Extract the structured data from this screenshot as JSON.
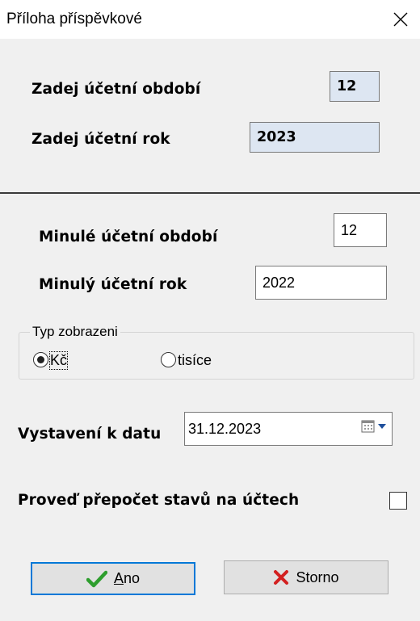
{
  "window": {
    "title": "Příloha příspěvkové"
  },
  "current": {
    "period_label": "Zadej účetní období",
    "period_value": "12",
    "year_label": "Zadej účetní rok",
    "year_value": "2023"
  },
  "previous": {
    "period_label": "Minulé účetní období",
    "period_value": "12",
    "year_label": "Minulý účetní rok",
    "year_value": "2022"
  },
  "display_type": {
    "legend": "Typ zobrazeni",
    "options": [
      {
        "label": "Kč",
        "selected": true
      },
      {
        "label": "tisíce",
        "selected": false
      }
    ]
  },
  "issue_date": {
    "label": "Vystavení k datu",
    "value": "31.12.2023"
  },
  "recalc": {
    "label": "Proveď přepočet stavů na účtech",
    "checked": false
  },
  "buttons": {
    "ok_accel": "A",
    "ok_rest": "no",
    "cancel_label": "Storno"
  },
  "colors": {
    "readonly_field": "#dde6f2",
    "default_button_border": "#0078d7",
    "check_icon": "#2e9e2e",
    "x_icon": "#d32020"
  },
  "icons": [
    "close-icon",
    "calendar-icon",
    "dropdown-arrow-icon",
    "checkmark-icon",
    "x-icon"
  ]
}
